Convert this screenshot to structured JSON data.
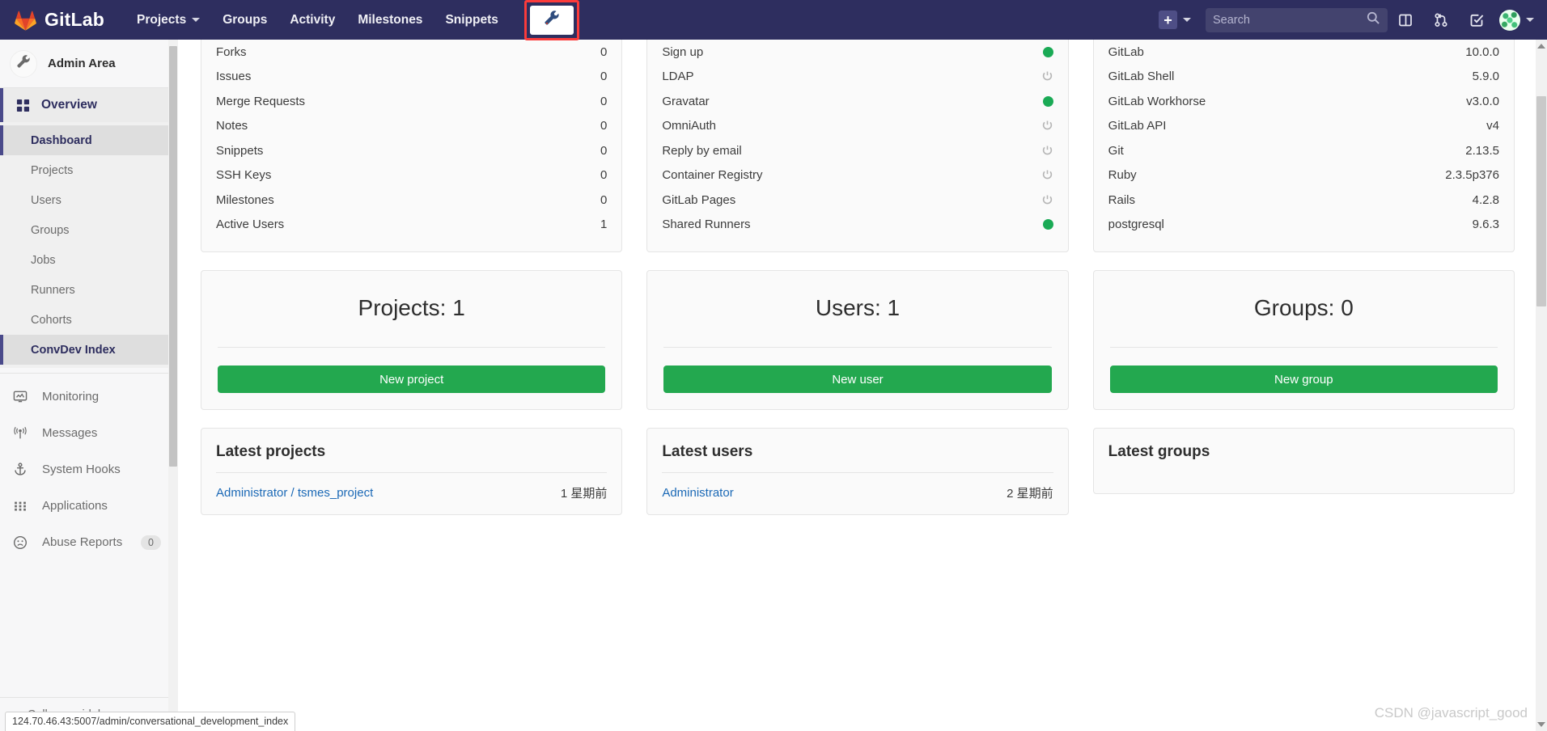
{
  "navbar": {
    "brand": "GitLab",
    "links": [
      {
        "label": "Projects",
        "has_caret": true
      },
      {
        "label": "Groups",
        "has_caret": false
      },
      {
        "label": "Activity",
        "has_caret": false
      },
      {
        "label": "Milestones",
        "has_caret": false
      },
      {
        "label": "Snippets",
        "has_caret": false
      }
    ],
    "admin_button_icon": "wrench-icon",
    "admin_button_highlight_color": "#fb3b3b",
    "plus_label": "+",
    "search": {
      "value": "",
      "placeholder": "Search"
    },
    "icons": [
      "issues-board-icon",
      "merge-requests-icon",
      "todos-icon"
    ],
    "background_color": "#2e2e5f"
  },
  "sidebar": {
    "title": "Admin Area",
    "group": {
      "label": "Overview",
      "icon": "grid-icon"
    },
    "sub_items": [
      {
        "label": "Dashboard",
        "active": true
      },
      {
        "label": "Projects",
        "active": false
      },
      {
        "label": "Users",
        "active": false
      },
      {
        "label": "Groups",
        "active": false
      },
      {
        "label": "Jobs",
        "active": false
      },
      {
        "label": "Runners",
        "active": false
      },
      {
        "label": "Cohorts",
        "active": false
      },
      {
        "label": "ConvDev Index",
        "active": true
      }
    ],
    "main_items": [
      {
        "label": "Monitoring",
        "icon": "monitor-icon",
        "badge": ""
      },
      {
        "label": "Messages",
        "icon": "broadcast-icon",
        "badge": ""
      },
      {
        "label": "System Hooks",
        "icon": "hook-icon",
        "badge": ""
      },
      {
        "label": "Applications",
        "icon": "apps-grid-icon",
        "badge": ""
      },
      {
        "label": "Abuse Reports",
        "icon": "frown-icon",
        "badge": "0"
      }
    ],
    "collapse_label": "Collapse sidebar"
  },
  "statistics": {
    "rows": [
      {
        "label": "Forks",
        "value": "0"
      },
      {
        "label": "Issues",
        "value": "0"
      },
      {
        "label": "Merge Requests",
        "value": "0"
      },
      {
        "label": "Notes",
        "value": "0"
      },
      {
        "label": "Snippets",
        "value": "0"
      },
      {
        "label": "SSH Keys",
        "value": "0"
      },
      {
        "label": "Milestones",
        "value": "0"
      },
      {
        "label": "Active Users",
        "value": "1"
      }
    ]
  },
  "features": {
    "rows": [
      {
        "label": "Sign up",
        "state": "on"
      },
      {
        "label": "LDAP",
        "state": "off"
      },
      {
        "label": "Gravatar",
        "state": "on"
      },
      {
        "label": "OmniAuth",
        "state": "off"
      },
      {
        "label": "Reply by email",
        "state": "off"
      },
      {
        "label": "Container Registry",
        "state": "off"
      },
      {
        "label": "GitLab Pages",
        "state": "off"
      },
      {
        "label": "Shared Runners",
        "state": "on"
      }
    ],
    "on_color": "#1aaa55",
    "off_color": "#b5b5b5"
  },
  "components": {
    "rows": [
      {
        "label": "GitLab",
        "value": "10.0.0"
      },
      {
        "label": "GitLab Shell",
        "value": "5.9.0"
      },
      {
        "label": "GitLab Workhorse",
        "value": "v3.0.0"
      },
      {
        "label": "GitLab API",
        "value": "v4"
      },
      {
        "label": "Git",
        "value": "2.13.5"
      },
      {
        "label": "Ruby",
        "value": "2.3.5p376"
      },
      {
        "label": "Rails",
        "value": "4.2.8"
      },
      {
        "label": "postgresql",
        "value": "9.6.3"
      }
    ]
  },
  "count_cards": [
    {
      "title": "Projects: 1",
      "button": "New project"
    },
    {
      "title": "Users: 1",
      "button": "New user"
    },
    {
      "title": "Groups: 0",
      "button": "New group"
    }
  ],
  "latest": [
    {
      "title": "Latest projects",
      "rows": [
        {
          "name": "Administrator / tsmes_project",
          "time": "1 星期前"
        }
      ]
    },
    {
      "title": "Latest users",
      "rows": [
        {
          "name": "Administrator",
          "time": "2 星期前"
        }
      ]
    },
    {
      "title": "Latest groups",
      "rows": []
    }
  ],
  "status_bar": {
    "url": "124.70.46.43:5007/admin/conversational_development_index"
  },
  "watermark": {
    "text": "CSDN @javascript_good"
  },
  "theme": {
    "green_button": "#23a84f",
    "link_blue": "#1b69b6",
    "nav_bg": "#2e2e5f"
  }
}
